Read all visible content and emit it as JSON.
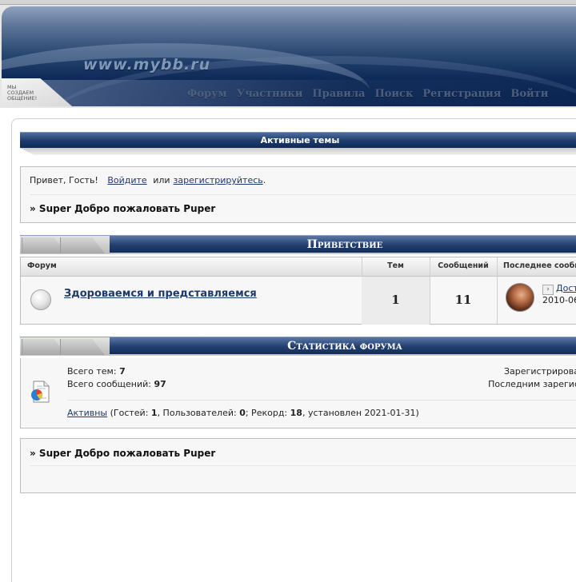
{
  "header": {
    "site_logo": "www.mybb.ru",
    "slogan_line1": "мы",
    "slogan_line2": "создаем",
    "slogan_line3": "общение!",
    "nav": [
      "Форум",
      "Участники",
      "Правила",
      "Поиск",
      "Регистрация",
      "Войти"
    ]
  },
  "active_topics": {
    "title": "Активные темы"
  },
  "welcome": {
    "greeting": "Привет, Гость!",
    "login_link": "Войдите",
    "or_text": "или",
    "register_link": "зарегистрируйтесь",
    "period": ".",
    "announcement": "» Super Добро пожаловать Puper"
  },
  "category_welcome": {
    "title": "Приветствие",
    "columns": [
      "Форум",
      "Тем",
      "Сообщений",
      "Последнее сообщ"
    ],
    "forum": {
      "name": "Здороваемся и представляемся",
      "topics": "1",
      "posts": "11",
      "last_post_link": "Дост",
      "last_post_date": "2010-06"
    }
  },
  "stats": {
    "title": "Статистика форума",
    "total_topics_label": "Всего тем:",
    "total_topics": "7",
    "total_posts_label": "Всего сообщений:",
    "total_posts": "97",
    "registered_label": "Зарегистрирова",
    "last_registered_label": "Последним зарегис",
    "active_link": "Активны",
    "guests_label": "(Гостей:",
    "guests": "1",
    "users_label": ", Пользователей:",
    "users": "0",
    "record_label": "; Рекорд:",
    "record": "18",
    "record_date": ", установлен 2021-01-31)"
  },
  "bottom": {
    "announcement": "» Super Добро пожаловать Puper"
  },
  "colors": {
    "accent": "#1c3a6a",
    "link": "#1e3a6b"
  }
}
